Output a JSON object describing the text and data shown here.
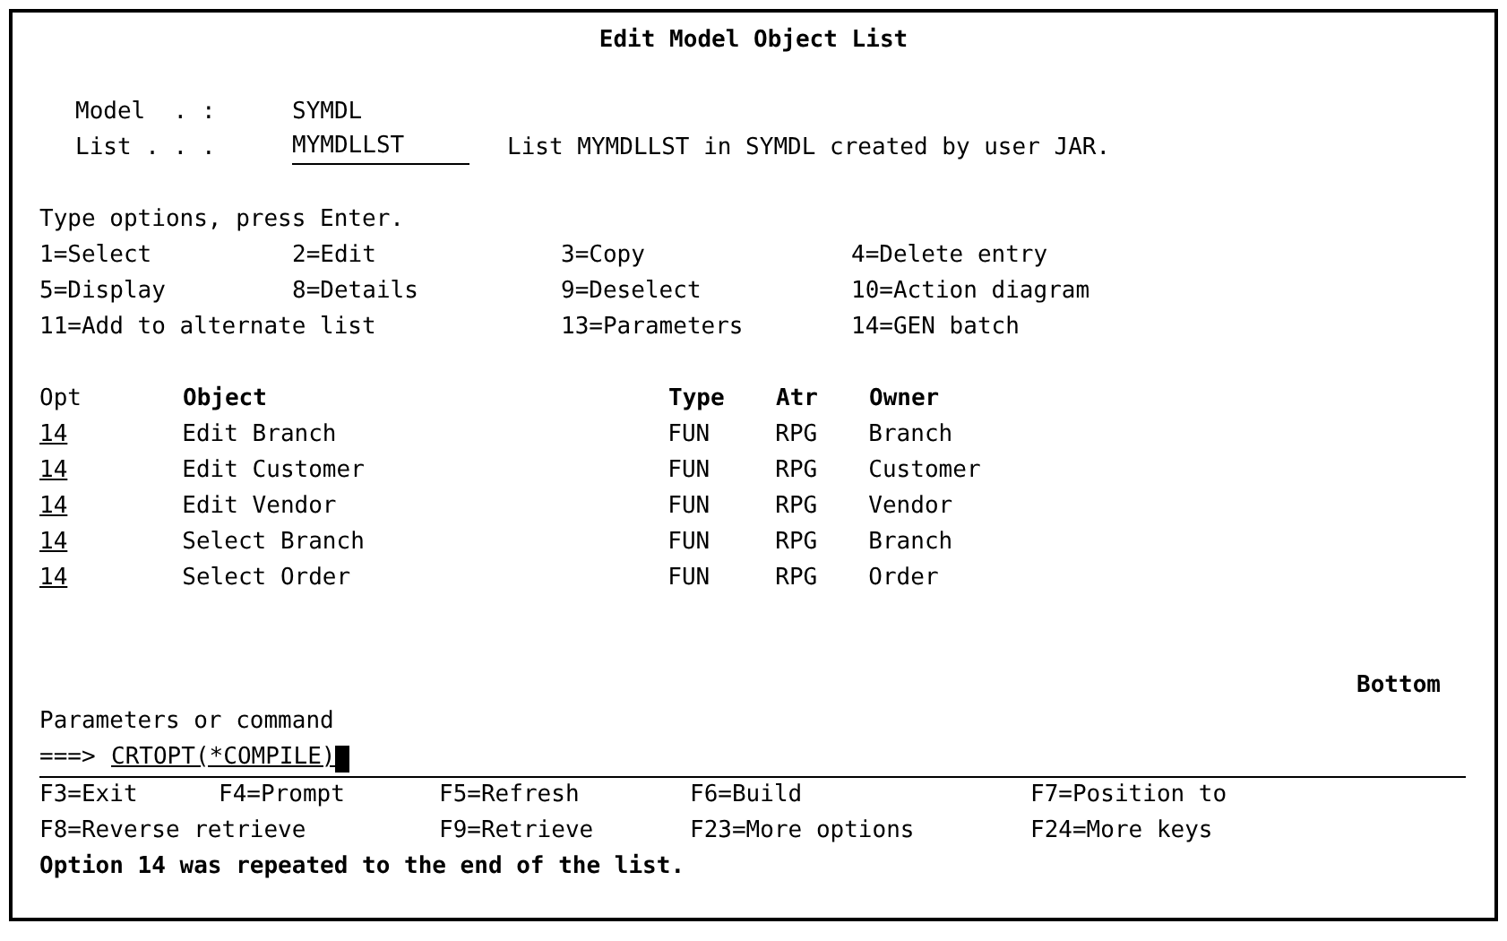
{
  "title": "Edit Model Object List",
  "header_fields": [
    {
      "label": "Model  . :",
      "value": "SYMDL",
      "kind": "output"
    },
    {
      "label": "List . . .",
      "value": "MYMDLLST",
      "kind": "input",
      "description": "List MYMDLLST in SYMDL created by user JAR."
    }
  ],
  "instructions": "Type options, press Enter.",
  "options": [
    [
      "1=Select",
      "2=Edit",
      "3=Copy",
      "4=Delete entry"
    ],
    [
      "5=Display",
      "8=Details",
      "9=Deselect",
      "10=Action diagram"
    ],
    [
      "11=Add to alternate list",
      "13=Parameters",
      "14=GEN batch"
    ]
  ],
  "table": {
    "columns": [
      {
        "label": "Opt",
        "highlight": false
      },
      {
        "label": "Object",
        "highlight": true
      },
      {
        "label": "Type",
        "highlight": true
      },
      {
        "label": "Atr",
        "highlight": true
      },
      {
        "label": "Owner",
        "highlight": true
      }
    ],
    "rows": [
      {
        "opt": "14",
        "object": "Edit Branch",
        "type": "FUN",
        "atr": "RPG",
        "owner": "Branch"
      },
      {
        "opt": "14",
        "object": "Edit Customer",
        "type": "FUN",
        "atr": "RPG",
        "owner": "Customer"
      },
      {
        "opt": "14",
        "object": "Edit Vendor",
        "type": "FUN",
        "atr": "RPG",
        "owner": "Vendor"
      },
      {
        "opt": "14",
        "object": "Select Branch",
        "type": "FUN",
        "atr": "RPG",
        "owner": "Branch"
      },
      {
        "opt": "14",
        "object": "Select Order",
        "type": "FUN",
        "atr": "RPG",
        "owner": "Order"
      }
    ]
  },
  "list_position": "Bottom",
  "command": {
    "label": "Parameters or command",
    "prompt": "===>",
    "value": "CRTOPT(*COMPILE)"
  },
  "function_keys": [
    [
      "F3=Exit",
      "F4=Prompt",
      "F5=Refresh",
      "F6=Build",
      "F7=Position to"
    ],
    [
      "F8=Reverse retrieve",
      "F9=Retrieve",
      "F23=More options",
      "F24=More keys"
    ]
  ],
  "message": "Option 14 was repeated to the end of the list."
}
